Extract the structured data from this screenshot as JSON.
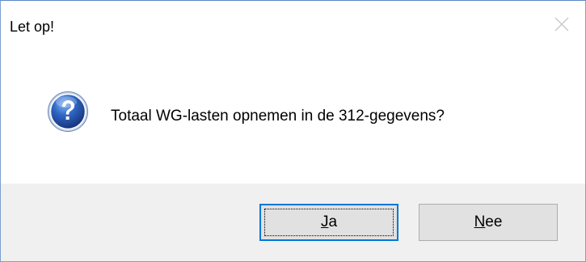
{
  "dialog": {
    "title": "Let op!",
    "message": "Totaal WG-lasten opnemen in de 312-gegevens?",
    "icon": "question-icon",
    "close_icon": "close-icon"
  },
  "buttons": {
    "yes": {
      "mnemonic": "J",
      "rest": "a"
    },
    "no": {
      "mnemonic": "N",
      "rest": "ee"
    }
  },
  "colors": {
    "footer_bg": "#f0f0f0",
    "default_button_border": "#0078d7",
    "button_bg": "#e1e1e1",
    "icon_blue": "#2a5aa8"
  }
}
